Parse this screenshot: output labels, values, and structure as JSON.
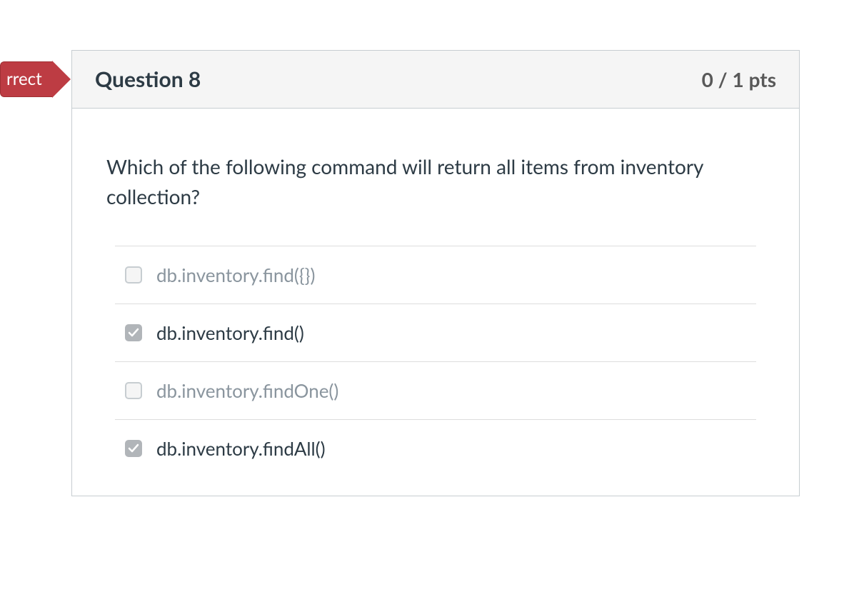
{
  "status_flag": "rrect",
  "header": {
    "title": "Question 8",
    "points": "0 / 1 pts"
  },
  "question_text": "Which of the following command will return all items from inventory collection?",
  "options": [
    {
      "label": "db.inventory.find({})",
      "checked": false,
      "muted": true
    },
    {
      "label": "db.inventory.find()",
      "checked": true,
      "muted": false
    },
    {
      "label": "db.inventory.findOne()",
      "checked": false,
      "muted": true
    },
    {
      "label": "db.inventory.findAll()",
      "checked": true,
      "muted": false
    }
  ]
}
